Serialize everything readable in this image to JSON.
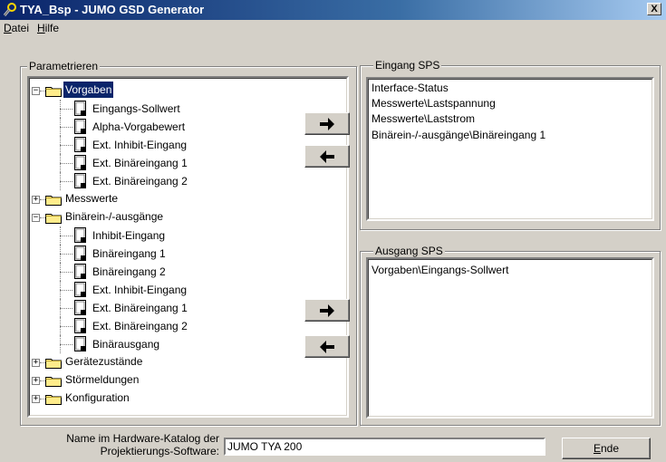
{
  "window": {
    "title": "TYA_Bsp - JUMO GSD Generator",
    "close_label": "X"
  },
  "menu": [
    {
      "mnemonic": "D",
      "rest": "atei"
    },
    {
      "mnemonic": "H",
      "rest": "ilfe"
    }
  ],
  "parametrieren": {
    "label": "Parametrieren",
    "tree": [
      {
        "label": "Vorgaben",
        "kind": "folder",
        "expander": "−",
        "selected": true
      },
      {
        "label": "Eingangs-Sollwert",
        "kind": "doc"
      },
      {
        "label": "Alpha-Vorgabewert",
        "kind": "doc"
      },
      {
        "label": "Ext. Inhibit-Eingang",
        "kind": "doc"
      },
      {
        "label": "Ext. Binäreingang 1",
        "kind": "doc"
      },
      {
        "label": "Ext. Binäreingang 2",
        "kind": "doc"
      },
      {
        "label": "Messwerte",
        "kind": "folder",
        "expander": "+"
      },
      {
        "label": "Binärein-/-ausgänge",
        "kind": "folder",
        "expander": "−"
      },
      {
        "label": "Inhibit-Eingang",
        "kind": "doc"
      },
      {
        "label": "Binäreingang 1",
        "kind": "doc"
      },
      {
        "label": "Binäreingang 2",
        "kind": "doc"
      },
      {
        "label": "Ext. Inhibit-Eingang",
        "kind": "doc"
      },
      {
        "label": "Ext. Binäreingang 1",
        "kind": "doc"
      },
      {
        "label": "Ext. Binäreingang 2",
        "kind": "doc"
      },
      {
        "label": "Binärausgang",
        "kind": "doc"
      },
      {
        "label": "Gerätezustände",
        "kind": "folder",
        "expander": "+"
      },
      {
        "label": "Störmeldungen",
        "kind": "folder",
        "expander": "+"
      },
      {
        "label": "Konfiguration",
        "kind": "folder",
        "expander": "+"
      }
    ]
  },
  "eingang_sps": {
    "label": "Eingang SPS",
    "items": [
      "Interface-Status",
      "Messwerte\\Lastspannung",
      "Messwerte\\Laststrom",
      "Binärein-/-ausgänge\\Binäreingang 1"
    ]
  },
  "ausgang_sps": {
    "label": "Ausgang SPS",
    "items": [
      "Vorgaben\\Eingangs-Sollwert"
    ]
  },
  "buttons": {
    "add_icon": "arrow-right-icon",
    "remove_icon": "arrow-left-icon"
  },
  "footer": {
    "catalog_label_line1": "Name im Hardware-Katalog der",
    "catalog_label_line2": "Projektierungs-Software:",
    "catalog_value": "JUMO TYA 200",
    "ende_mnemonic": "E",
    "ende_rest": "nde"
  },
  "colors": {
    "title_active": "#0a246a",
    "selection": "#0a246a",
    "face": "#d4d0c8"
  }
}
